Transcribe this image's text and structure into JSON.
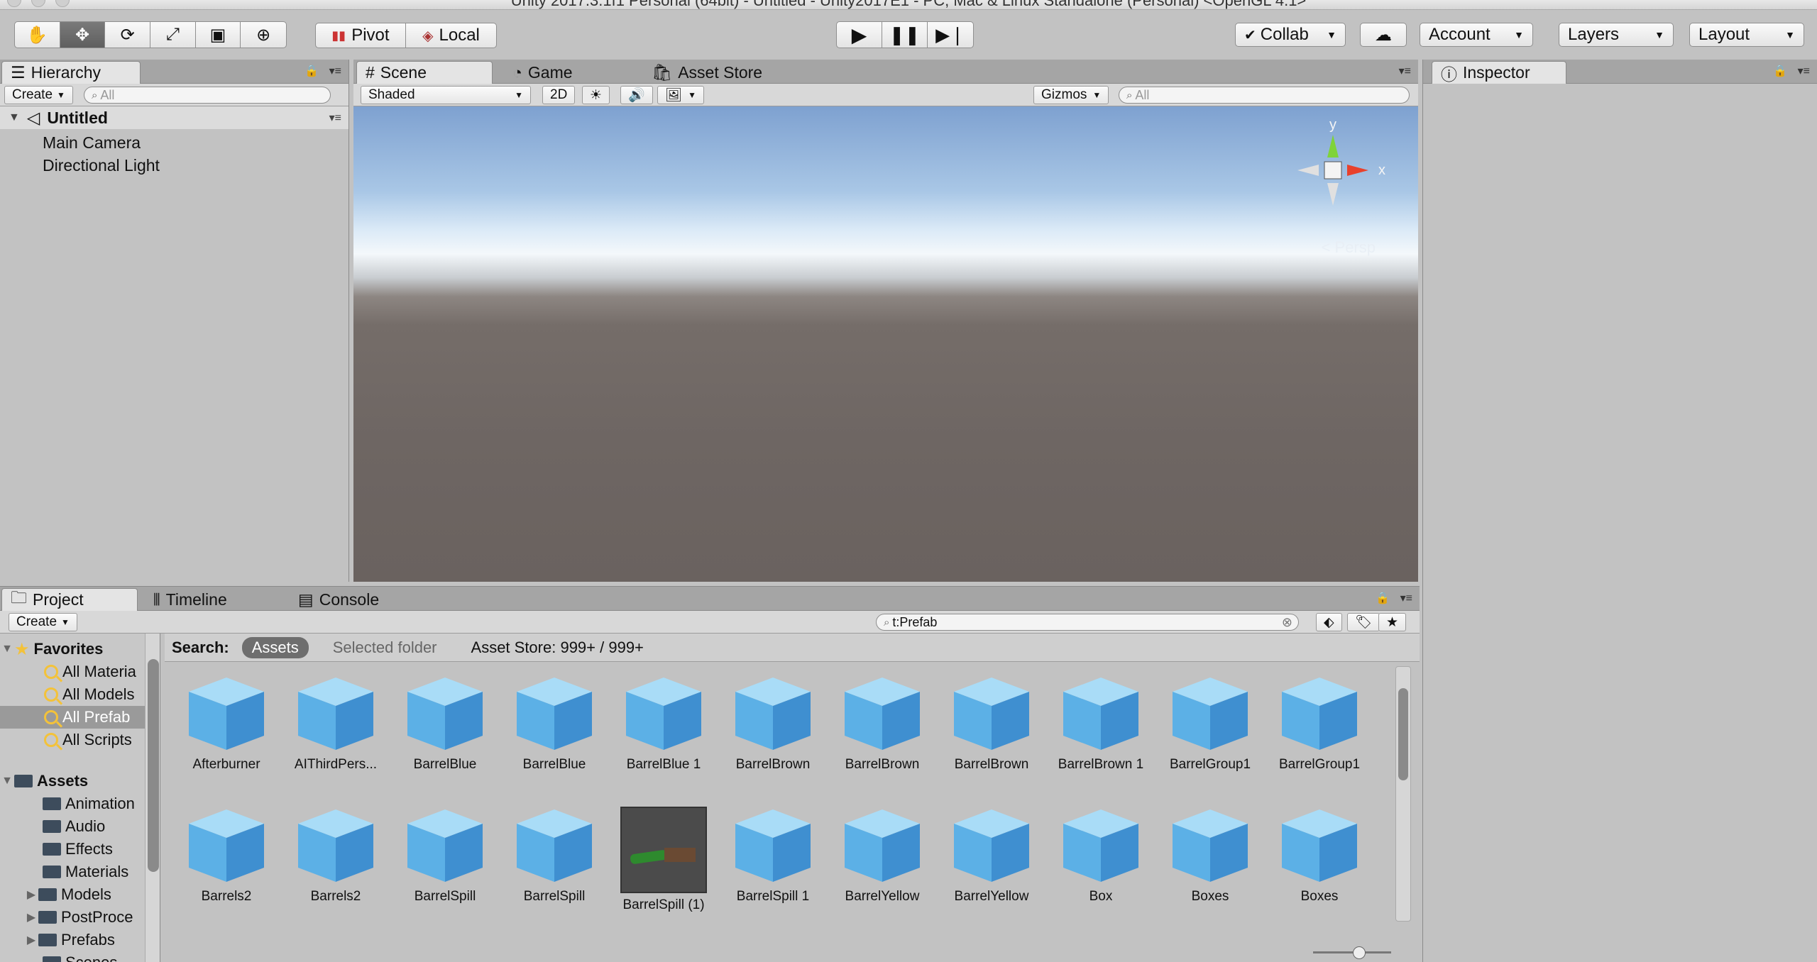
{
  "window": {
    "title": "Unity 2017.3.1f1 Personal (64bit) - Untitled - Unity2017E1 - PC, Mac & Linux Standalone (Personal) <OpenGL 4.1>"
  },
  "toolbar": {
    "tools": [
      "hand-tool",
      "move-tool",
      "rotate-tool",
      "scale-tool",
      "rect-tool",
      "transform-tool"
    ],
    "pivot_label": "Pivot",
    "local_label": "Local",
    "collab_label": "Collab",
    "account_label": "Account",
    "layers_label": "Layers",
    "layout_label": "Layout"
  },
  "hierarchy": {
    "tab_label": "Hierarchy",
    "create_label": "Create",
    "search_placeholder": "All",
    "scene_name": "Untitled",
    "items": [
      "Main Camera",
      "Directional Light"
    ]
  },
  "scene": {
    "tabs": [
      "Scene",
      "Game",
      "Asset Store"
    ],
    "shading_mode": "Shaded",
    "mode_2d": "2D",
    "gizmos_label": "Gizmos",
    "search_placeholder": "All",
    "gizmo_y": "y",
    "gizmo_x": "x",
    "projection_label": "< Persp"
  },
  "inspector": {
    "tab_label": "Inspector"
  },
  "project": {
    "tabs": [
      "Project",
      "Timeline",
      "Console"
    ],
    "create_label": "Create",
    "search_value": "t:Prefab",
    "search_label": "Search:",
    "scope_assets": "Assets",
    "scope_selected": "Selected folder",
    "asset_store_label": "Asset Store: 999+ / 999+",
    "favorites_label": "Favorites",
    "favorites": [
      "All Materia",
      "All Models",
      "All Prefab",
      "All Scripts"
    ],
    "assets_label": "Assets",
    "folders": [
      "Animation",
      "Audio",
      "Effects",
      "Materials",
      "Models",
      "PostProce",
      "Prefabs",
      "Scenes"
    ],
    "asset_row1": [
      "Afterburner",
      "AIThirdPers...",
      "BarrelBlue",
      "BarrelBlue",
      "BarrelBlue 1",
      "BarrelBrown",
      "BarrelBrown",
      "BarrelBrown",
      "BarrelBrown 1",
      "BarrelGroup1",
      "BarrelGroup1"
    ],
    "asset_row2": [
      "Barrels2",
      "Barrels2",
      "BarrelSpill",
      "BarrelSpill",
      "BarrelSpill (1)",
      "BarrelSpill 1",
      "BarrelYellow",
      "BarrelYellow",
      "Box",
      "Boxes",
      "Boxes"
    ]
  },
  "colors": {
    "play_area": "#c2c2c2",
    "cube_light": "#8fd0f3",
    "cube_dark": "#3f8fd0",
    "gizmo_x": "#e8412c",
    "gizmo_y": "#7fd33a",
    "favorite_icon": "#f3c23a"
  }
}
